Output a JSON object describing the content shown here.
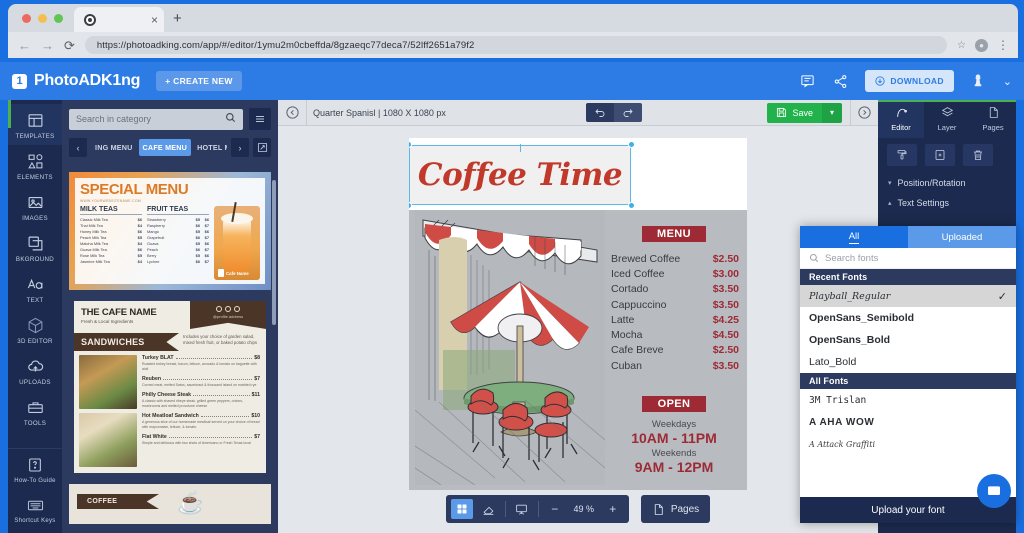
{
  "browser": {
    "tab_title": "",
    "url": "https://photoadking.com/app/#/editor/1ymu2m0cbeffda/8gzaeqc77deca7/52lff2651a79f2",
    "back_icon": "back-arrow-icon",
    "forward_icon": "forward-arrow-icon",
    "reload_icon": "reload-icon",
    "new_tab_icon": "+",
    "close_tab_icon": "×",
    "star_icon": "☆",
    "menu_icon": "⋮"
  },
  "header": {
    "brand_mark": "1",
    "brand": "PhotoADK1ng",
    "create_new": "+ CREATE NEW",
    "download": "DOWNLOAD",
    "comment_icon": "comment-icon",
    "share_icon": "share-icon",
    "crown_icon": "premium-icon",
    "chevron": "⌄"
  },
  "rail": {
    "items": [
      {
        "label": "TEMPLATES",
        "icon": "templates-icon",
        "active": true
      },
      {
        "label": "ELEMENTS",
        "icon": "elements-icon"
      },
      {
        "label": "IMAGES",
        "icon": "images-icon"
      },
      {
        "label": "BKGROUND",
        "icon": "background-icon"
      },
      {
        "label": "TEXT",
        "icon": "text-icon"
      },
      {
        "label": "3D EDITOR",
        "icon": "cube-icon"
      },
      {
        "label": "UPLOADS",
        "icon": "upload-cloud-icon"
      },
      {
        "label": "TOOLS",
        "icon": "toolbox-icon"
      }
    ],
    "bottom": [
      {
        "label": "How-To Guide",
        "icon": "question-icon"
      },
      {
        "label": "Shortcut Keys",
        "icon": "keyboard-icon"
      }
    ]
  },
  "templates_panel": {
    "search_placeholder": "Search in category",
    "search_value": "",
    "search_icon": "search-icon",
    "list_icon": "list-view-icon",
    "prev_arrow": "‹",
    "next_arrow": "›",
    "expand_icon": "expand-icon",
    "categories": [
      {
        "label": "ING MENU",
        "active": false
      },
      {
        "label": "CAFE MENU",
        "active": true
      },
      {
        "label": "HOTEL ME",
        "active": false
      }
    ],
    "template_special": {
      "title": "SPECIAL MENU",
      "url": "WWW.YOURWEBSITENAME.COM",
      "col1_head": "MILK TEAS",
      "col1": [
        {
          "name": "Classic Milk Tea",
          "price": "$6"
        },
        {
          "name": "Thai Milk Tea",
          "price": "$4"
        },
        {
          "name": "Honey Milk Tea",
          "price": "$6"
        },
        {
          "name": "Peach Milk Tea",
          "price": "$5"
        },
        {
          "name": "Matcha Milk Tea",
          "price": "$4"
        },
        {
          "name": "Guava Milk Tea",
          "price": "$6"
        },
        {
          "name": "Rose Milk Tea",
          "price": "$5"
        },
        {
          "name": "Jasmine Milk Tea",
          "price": "$4"
        }
      ],
      "col2_head": "FRUIT TEAS",
      "col2": [
        {
          "name": "Strawberry",
          "price": "$5",
          "price2": "$6"
        },
        {
          "name": "Raspberry",
          "price": "$6",
          "price2": "$7"
        },
        {
          "name": "Mango",
          "price": "$5",
          "price2": "$6"
        },
        {
          "name": "Grapefruit",
          "price": "$6",
          "price2": "$7"
        },
        {
          "name": "Guava",
          "price": "$5",
          "price2": "$6"
        },
        {
          "name": "Peach",
          "price": "$6",
          "price2": "$7"
        },
        {
          "name": "Berry",
          "price": "$5",
          "price2": "$6"
        },
        {
          "name": "Lychee",
          "price": "$6",
          "price2": "$7"
        }
      ],
      "badge": "Cafe Name"
    },
    "template_cafe": {
      "name": "THE CAFE NAME",
      "tagline": "Fresh & Local Ingredients",
      "handle": "@profile.address",
      "section": "SANDWICHES",
      "note": "Includes your choice of garden salad, mixed fresh fruit, or baked potato chips",
      "items": [
        {
          "name": "Turkey BLAT",
          "price": "$8",
          "desc": "Roasted turkey breast, bacon, lettuce, avocado & tomato on baguette with aioli"
        },
        {
          "name": "Reuben",
          "price": "$7",
          "desc": "Corned meat, melted Swiss, sauerkraut & thousand island on marbled rye"
        },
        {
          "name": "Philly Cheese Steak",
          "price": "$11",
          "desc": "A classic with shaved ribeye steak, grilled green peppers, onions, mushrooms and melted provolone cheese"
        },
        {
          "name": "Hot Meatloaf Sandwich",
          "price": "$10",
          "desc": "A generous slice of our homemade meatloaf served on your choice of bread with mayonnaise, lettuce, & tomato"
        },
        {
          "name": "Flat White",
          "price": "$7",
          "desc": "Simple and delicious with two shots of Americano or Fresh Texas local"
        }
      ]
    },
    "template_coffee": {
      "tab": "COFFEE",
      "cup_icon": "coffee-cup-icon"
    }
  },
  "canvas_toolbar": {
    "prev_icon": "chevron-left-circle-icon",
    "doc_title": "Quarter Spanisl | 1080 X 1080 px",
    "undo_icon": "undo-icon",
    "redo_icon": "redo-icon",
    "save_label": "Save",
    "save_icon": "floppy-disk-icon",
    "save_caret": "▾",
    "next_icon": "chevron-right-circle-icon"
  },
  "artboard": {
    "headline": "Coffee Time",
    "menu_badge": "MENU",
    "menu_items": [
      {
        "name": "Brewed Coffee",
        "price": "$2.50"
      },
      {
        "name": "Iced Coffee",
        "price": "$3.00"
      },
      {
        "name": "Cortado",
        "price": "$3.50"
      },
      {
        "name": "Cappuccino",
        "price": "$3.50"
      },
      {
        "name": "Latte",
        "price": "$4.25"
      },
      {
        "name": "Mocha",
        "price": "$4.50"
      },
      {
        "name": "Cafe Breve",
        "price": "$2.50"
      },
      {
        "name": "Cuban",
        "price": "$3.50"
      }
    ],
    "open_badge": "OPEN",
    "hours": [
      {
        "label": "Weekdays",
        "time": "10AM - 11PM"
      },
      {
        "label": "Weekends",
        "time": "9AM - 12PM"
      }
    ]
  },
  "canvas_bottom": {
    "grid_icon": "grid-view-icon",
    "eraser_icon": "eraser-icon",
    "present_icon": "presentation-icon",
    "zoom_out": "−",
    "zoom_value": "49 %",
    "zoom_in": "+",
    "pages_label": "Pages",
    "pages_icon": "page-icon"
  },
  "right_panel": {
    "tabs": [
      {
        "label": "Editor",
        "icon": "editor-pen-icon",
        "active": true
      },
      {
        "label": "Layer",
        "icon": "layers-icon",
        "active": false
      },
      {
        "label": "Pages",
        "icon": "page-icon",
        "active": false
      }
    ],
    "actions": [
      {
        "icon": "paint-roller-icon"
      },
      {
        "icon": "duplicate-icon"
      },
      {
        "icon": "trash-icon"
      }
    ],
    "sections": [
      {
        "label": "Position/Rotation",
        "caret": "▾"
      },
      {
        "label": "Text Settings",
        "caret": "▴"
      }
    ]
  },
  "font_popover": {
    "tab_all": "All",
    "tab_uploaded": "Uploaded",
    "search_placeholder": "Search fonts",
    "search_icon": "search-icon",
    "recent_header": "Recent Fonts",
    "recent_fonts": [
      {
        "name": "Playball_Regular",
        "selected": true,
        "style": "script"
      },
      {
        "name": "OpenSans_Semibold",
        "selected": false,
        "style": "semibold"
      },
      {
        "name": "OpenSans_Bold",
        "selected": false,
        "style": "bold"
      },
      {
        "name": "Lato_Bold",
        "selected": false,
        "style": "regular"
      }
    ],
    "all_header": "All Fonts",
    "all_fonts": [
      {
        "name": "3M Trislan",
        "style": "mono"
      },
      {
        "name": "A AHA WOW",
        "style": "wide"
      },
      {
        "name": "A Attack Graffiti",
        "style": "handwrite"
      }
    ],
    "upload_label": "Upload your font",
    "check_icon": "✓"
  },
  "chat": {
    "icon": "chat-bubble-icon"
  },
  "colors": {
    "brand_blue": "#2d7ce5",
    "navy": "#1b2a4e",
    "panel": "#2b3a5e",
    "accent_red": "#9e2a35",
    "save_green": "#22b24c",
    "select_blue": "#3fb0e5"
  }
}
